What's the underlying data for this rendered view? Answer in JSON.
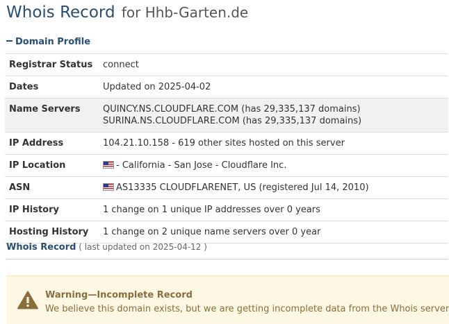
{
  "header": {
    "title": "Whois Record",
    "title_suffix": "for Hhb-Garten.de"
  },
  "domain_profile": {
    "toggle_label": "Domain Profile",
    "rows": {
      "registrar_status": {
        "label": "Registrar Status",
        "value": "connect"
      },
      "dates": {
        "label": "Dates",
        "value": "Updated on 2025-04-02"
      },
      "name_servers": {
        "label": "Name Servers",
        "values": [
          "QUINCY.NS.CLOUDFLARE.COM (has 29,335,137 domains)",
          "SURINA.NS.CLOUDFLARE.COM (has 29,335,137 domains)"
        ]
      },
      "ip_address": {
        "label": "IP Address",
        "ip": "104.21.10.158",
        "rest": " - 619 other sites hosted on this server"
      },
      "ip_location": {
        "label": "IP Location",
        "value": "- California - San Jose - Cloudflare Inc.",
        "flag_icon": "us-flag-icon"
      },
      "asn": {
        "label": "ASN",
        "value": "AS13335 CLOUDFLARENET, US (registered Jul 14, 2010)",
        "flag_icon": "us-flag-icon"
      },
      "ip_history": {
        "label": "IP History",
        "value": "1 change on 1 unique IP addresses over 0 years"
      },
      "hosting_history": {
        "label": "Hosting History",
        "value": "1 change on 2 unique name servers over 0 year"
      }
    }
  },
  "whois_record": {
    "title": "Whois Record",
    "note": "( last updated on 2025-04-12 )"
  },
  "warning": {
    "icon": "warning-triangle-icon",
    "title": "Warning—Incomplete Record",
    "text": "We believe this domain exists, but we are getting incomplete data from the Whois server."
  },
  "colors": {
    "heading": "#2a4d72",
    "warning_bg": "#fcf8e3",
    "warning_text": "#8a6d3b",
    "row_shade": "#f1f1f1"
  }
}
